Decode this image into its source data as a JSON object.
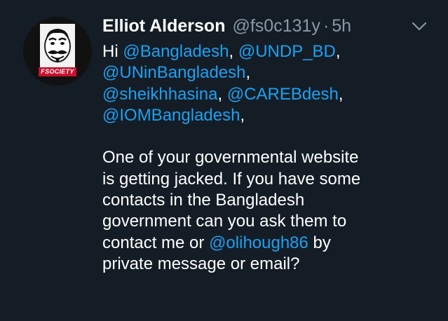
{
  "tweet": {
    "display_name": "Elliot Alderson",
    "handle": "@fs0c131y",
    "separator": "·",
    "time": "5h",
    "avatar_text": "FSOCIETY",
    "mentions": {
      "m1": "@Bangladesh",
      "m2": "@UNDP_BD",
      "m3": "@UNinBangladesh",
      "m4": "@sheikhhasina",
      "m5": "@CAREBdesh",
      "m6": "@IOMBangladesh",
      "m7": "@olihough86"
    },
    "text": {
      "hi": "Hi ",
      "comma1": ", ",
      "comma2": ",",
      "comma3": ",",
      "comma4": ", ",
      "comma5": ",",
      "comma6": ",",
      "p2_line1": "One of your governmental website",
      "p2_line2": "is getting jacked. If you have some",
      "p2_line3": "contacts in the Bangladesh",
      "p2_line4": "government can you ask them to",
      "p2_line5_a": "contact me or ",
      "p2_line5_b": " by",
      "p2_line6": "private message or email?"
    },
    "colors": {
      "background": "#141d26",
      "link": "#1da1f2",
      "muted": "#8899a6",
      "text": "#ffffff"
    },
    "icons": {
      "caret": "chevron-down-icon",
      "avatar": "fsociety-mask-avatar"
    }
  }
}
